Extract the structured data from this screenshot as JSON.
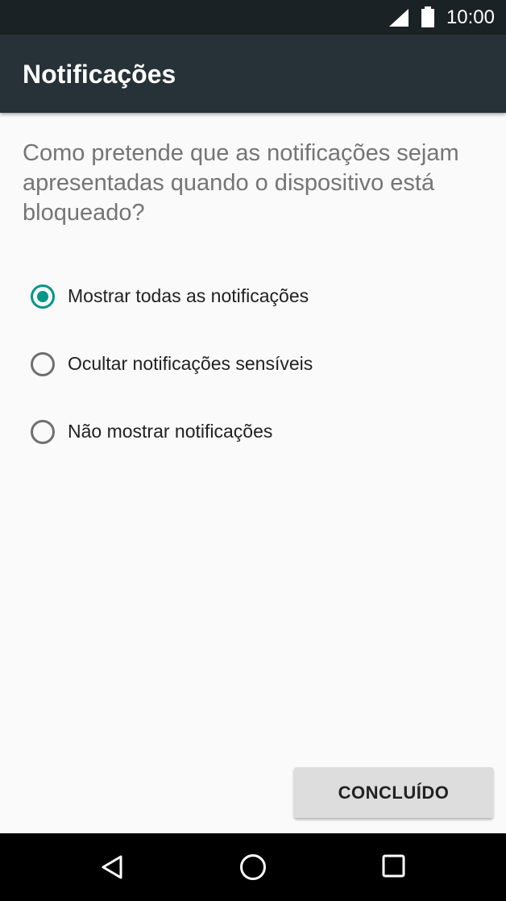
{
  "status_bar": {
    "time": "10:00",
    "signal_icon": "cell-signal-icon",
    "battery_icon": "battery-icon"
  },
  "app_bar": {
    "title": "Notificações"
  },
  "main": {
    "question": "Como pretende que as notificações sejam apresentadas quando o dispositivo está bloqueado?",
    "options": [
      {
        "label": "Mostrar todas as notificações",
        "selected": true
      },
      {
        "label": "Ocultar notificações sensíveis",
        "selected": false
      },
      {
        "label": "Não mostrar notificações",
        "selected": false
      }
    ],
    "done_label": "CONCLUÍDO"
  },
  "nav_bar": {
    "icons": [
      "back-icon",
      "home-icon",
      "recents-icon"
    ]
  },
  "colors": {
    "accent": "#009688",
    "app_bar": "#263238",
    "status_bar": "#1a2226",
    "background": "#fafafa"
  }
}
